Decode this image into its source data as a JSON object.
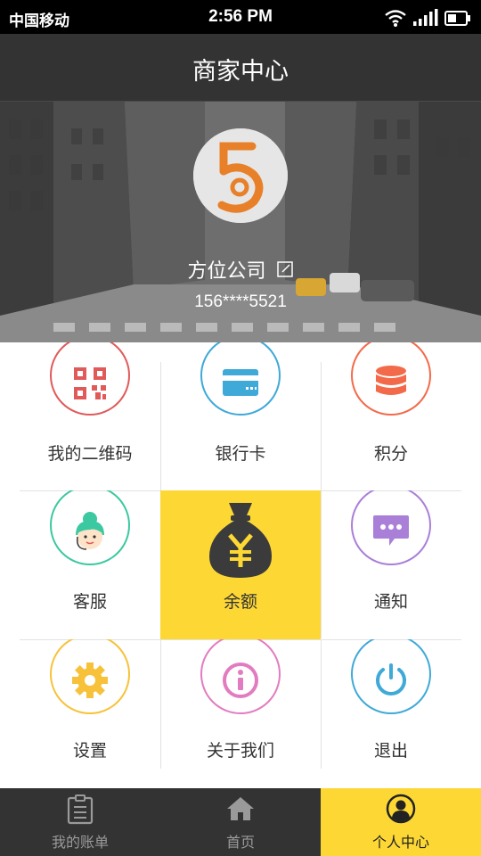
{
  "status_bar": {
    "carrier": "中国移动",
    "time": "2:56 PM"
  },
  "header": {
    "title": "商家中心"
  },
  "profile": {
    "company_name": "方位公司",
    "phone": "156****5521",
    "avatar_text": "5"
  },
  "grid": {
    "items": [
      {
        "label": "我的二维码",
        "icon": "qr-code-icon",
        "color": "#e05a5a"
      },
      {
        "label": "银行卡",
        "icon": "bank-card-icon",
        "color": "#3fa9d8"
      },
      {
        "label": "积分",
        "icon": "coin-stack-icon",
        "color": "#f36a4a"
      },
      {
        "label": "客服",
        "icon": "customer-service-icon",
        "color": "#3cc8a0"
      },
      {
        "label": "余额",
        "icon": "money-bag-icon",
        "color": "#fdd835"
      },
      {
        "label": "通知",
        "icon": "message-icon",
        "color": "#a97fd8"
      },
      {
        "label": "设置",
        "icon": "gear-icon",
        "color": "#f7c23a"
      },
      {
        "label": "关于我们",
        "icon": "info-icon",
        "color": "#e27cc0"
      },
      {
        "label": "退出",
        "icon": "power-icon",
        "color": "#3fa9d8"
      }
    ]
  },
  "tabbar": {
    "tabs": [
      {
        "label": "我的账单",
        "icon": "bill-icon"
      },
      {
        "label": "首页",
        "icon": "home-icon"
      },
      {
        "label": "个人中心",
        "icon": "user-icon"
      }
    ],
    "active_color": "#fdd835"
  }
}
